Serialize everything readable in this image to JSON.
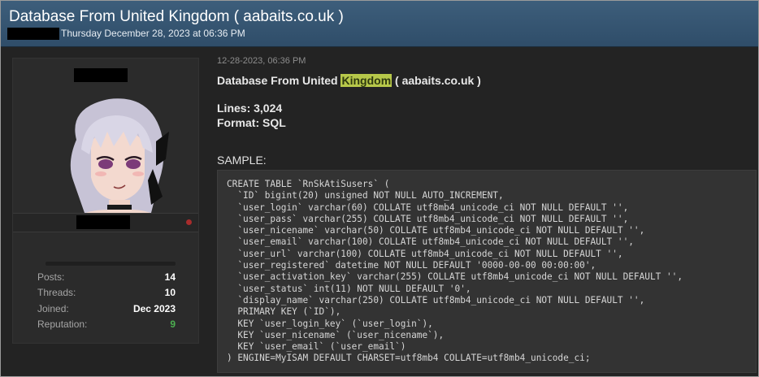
{
  "thread": {
    "title": "Database From United Kingdom ( aabaits.co.uk )",
    "date": "Thursday December 28, 2023 at 06:36 PM"
  },
  "user": {
    "stats": [
      {
        "label": "Posts:",
        "value": "14"
      },
      {
        "label": "Threads:",
        "value": "10"
      },
      {
        "label": "Joined:",
        "value": "Dec 2023"
      },
      {
        "label": "Reputation:",
        "value": "9"
      }
    ],
    "reputation_color": "#4caf50"
  },
  "post": {
    "date": "12-28-2023, 06:36 PM",
    "title_before": "Database From United ",
    "title_highlight": "Kingdom",
    "title_after": " ( aabaits.co.uk )",
    "lines": "Lines: 3,024",
    "format": "Format: SQL",
    "sample_label": "SAMPLE:",
    "code_lines": [
      "CREATE TABLE `RnSkAtiSusers` (",
      "  `ID` bigint(20) unsigned NOT NULL AUTO_INCREMENT,",
      "  `user_login` varchar(60) COLLATE utf8mb4_unicode_ci NOT NULL DEFAULT '',",
      "  `user_pass` varchar(255) COLLATE utf8mb4_unicode_ci NOT NULL DEFAULT '',",
      "  `user_nicename` varchar(50) COLLATE utf8mb4_unicode_ci NOT NULL DEFAULT '',",
      "  `user_email` varchar(100) COLLATE utf8mb4_unicode_ci NOT NULL DEFAULT '',",
      "  `user_url` varchar(100) COLLATE utf8mb4_unicode_ci NOT NULL DEFAULT '',",
      "  `user_registered` datetime NOT NULL DEFAULT '0000-00-00 00:00:00',",
      "  `user_activation_key` varchar(255) COLLATE utf8mb4_unicode_ci NOT NULL DEFAULT '',",
      "  `user_status` int(11) NOT NULL DEFAULT '0',",
      "  `display_name` varchar(250) COLLATE utf8mb4_unicode_ci NOT NULL DEFAULT '',",
      "  PRIMARY KEY (`ID`),",
      "  KEY `user_login_key` (`user_login`),",
      "  KEY `user_nicename` (`user_nicename`),",
      "  KEY `user_email` (`user_email`)",
      ") ENGINE=MyISAM DEFAULT CHARSET=utf8mb4 COLLATE=utf8mb4_unicode_ci;"
    ]
  },
  "colors": {
    "header": "#2f4d69",
    "background": "#232323",
    "highlight": "#b7c84a",
    "status_offline": "#a82c2c"
  },
  "icons": {
    "avatar": "anime-avatar-icon",
    "status": "offline-status-icon"
  }
}
